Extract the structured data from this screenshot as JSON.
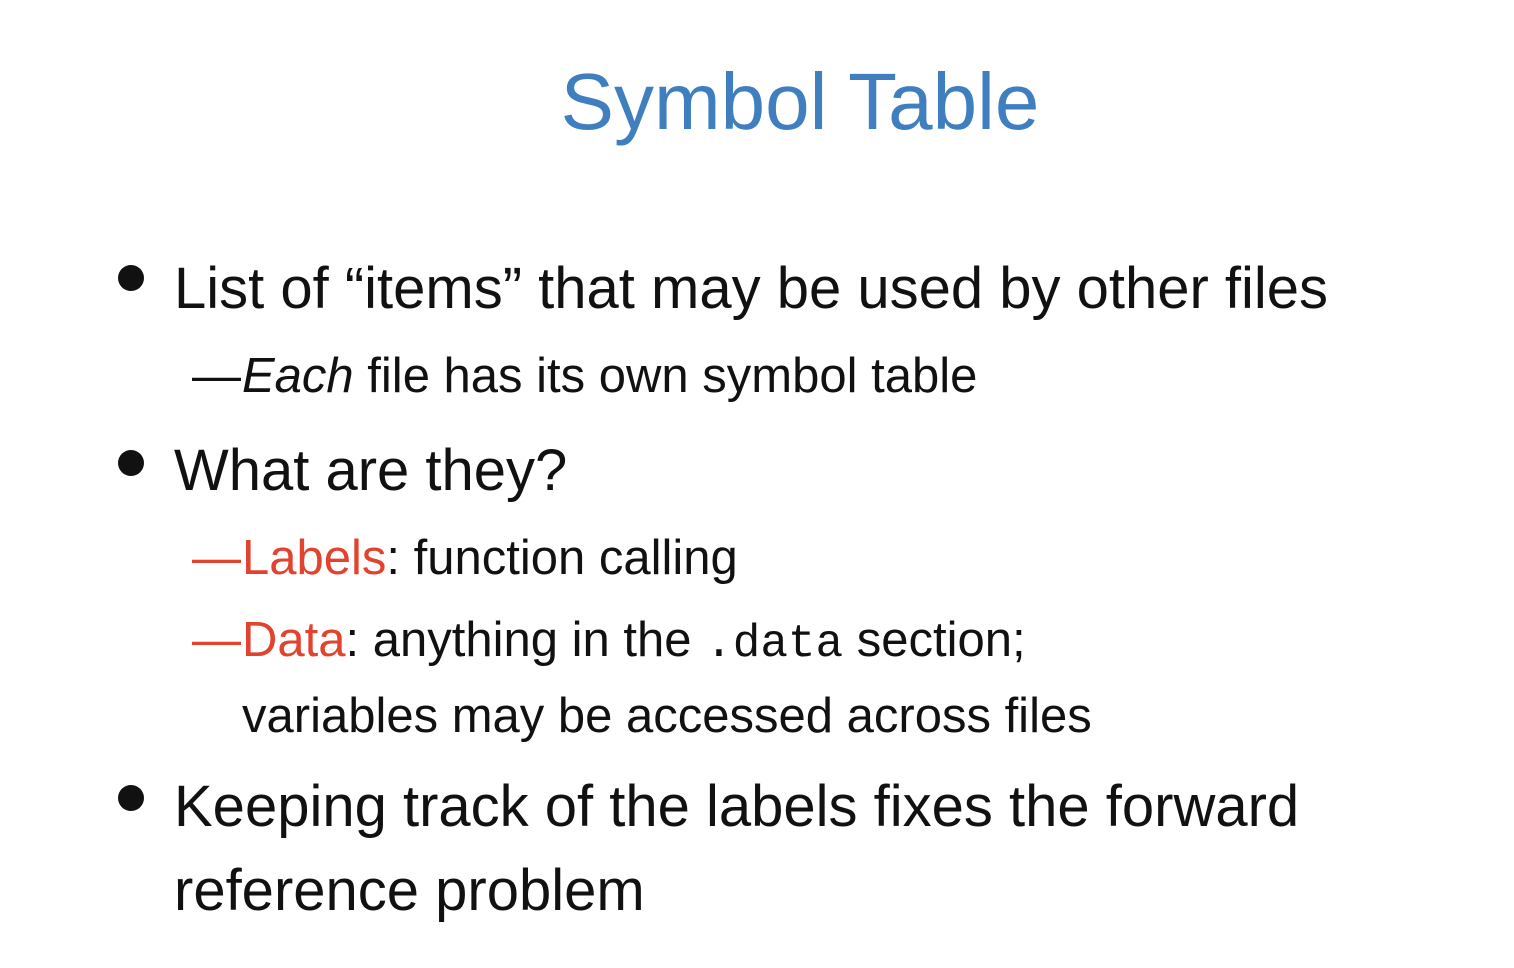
{
  "slide": {
    "title": "Symbol Table",
    "bullets": [
      {
        "text": "List of “items” that may be used by other files",
        "sub": [
          {
            "dash": "—",
            "italic_word": "Each",
            "rest": " file has its own symbol table"
          }
        ]
      },
      {
        "text": "What are they?",
        "sub": [
          {
            "dash": "—",
            "label": "Labels",
            "rest": ":  function calling"
          },
          {
            "dash": "—",
            "label": "Data",
            "rest_before_code": ":  anything in the ",
            "code": ".data",
            "rest_after_code": " section;",
            "continuation": "variables may be accessed across files"
          }
        ]
      },
      {
        "text": "Keeping track of the labels fixes the forward",
        "continuation": "reference problem"
      }
    ]
  },
  "colors": {
    "title": "#3f7fbf",
    "text": "#111111",
    "accent": "#e2432f"
  }
}
